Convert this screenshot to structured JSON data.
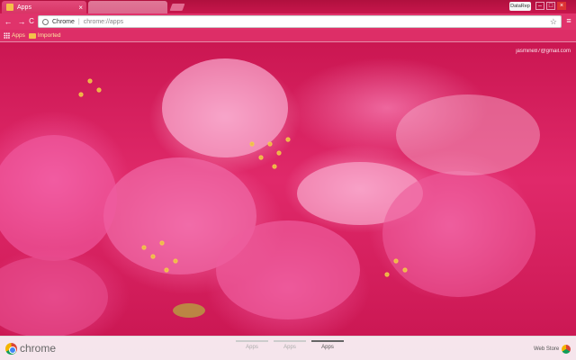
{
  "tabs": [
    {
      "title": "Apps",
      "active": true,
      "close_glyph": "×"
    },
    {
      "title": "",
      "active": false
    }
  ],
  "profile_button": "DataRep",
  "window_controls": {
    "minimize": "–",
    "maximize": "□",
    "close": "×"
  },
  "toolbar": {
    "back_glyph": "←",
    "forward_glyph": "→",
    "reload_glyph": "C",
    "origin": "Chrome",
    "separator": "|",
    "url": "chrome://apps",
    "star_glyph": "☆",
    "menu_glyph": "≡"
  },
  "bookmarks": [
    {
      "icon": "apps-grid-icon",
      "label": "Apps"
    },
    {
      "icon": "folder-icon",
      "label": "Imported"
    }
  ],
  "account_email": "jasmine87@gmail.com",
  "bottom_bar": {
    "brand": "chrome",
    "page_tabs": [
      {
        "label": "Apps",
        "active": false
      },
      {
        "label": "Apps",
        "active": false
      },
      {
        "label": "Apps",
        "active": true
      }
    ],
    "webstore_label": "Web Store"
  },
  "colors": {
    "tabstrip": "#c8164c",
    "toolbar": "#e0336b",
    "bookmark_label": "#ffe8a0"
  }
}
